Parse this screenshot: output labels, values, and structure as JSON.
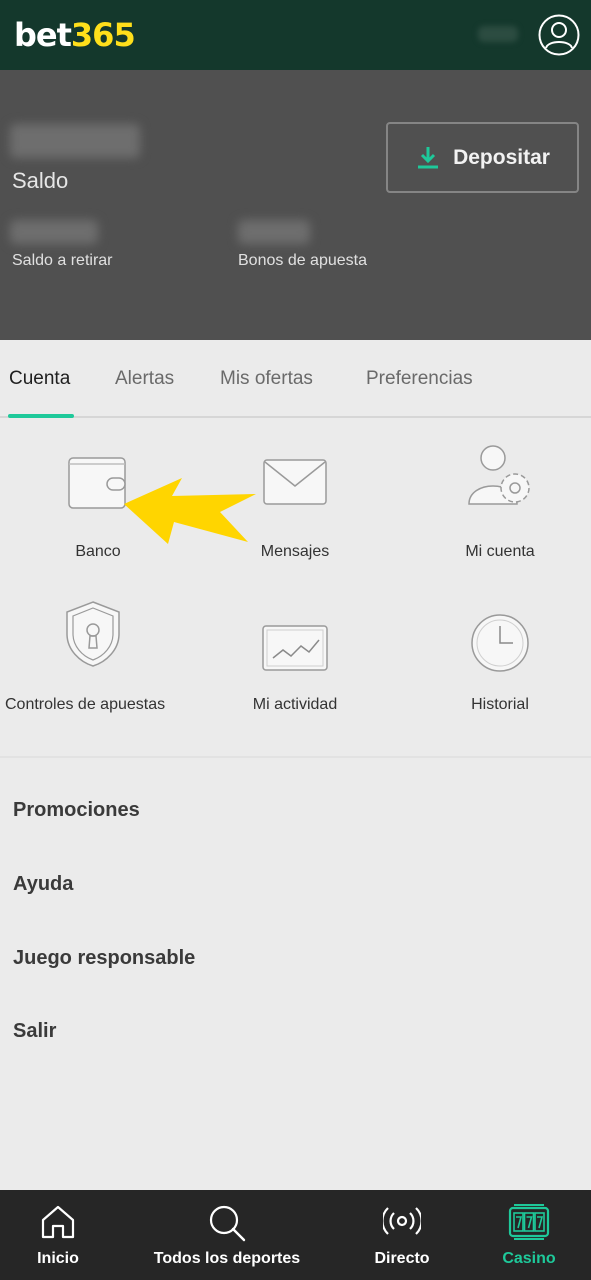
{
  "header": {
    "logo_part1": "bet",
    "logo_part2": "365",
    "account_icon": "user-circle-icon",
    "brand_green": "#14382c",
    "brand_yellow": "#ffdf1b"
  },
  "balance": {
    "saldo_label": "Saldo",
    "withdraw_label": "Saldo a retirar",
    "bonus_label": "Bonos de apuesta",
    "deposit_label": "Depositar",
    "deposit_icon": "download-icon"
  },
  "tabs": [
    {
      "label": "Cuenta",
      "active": true
    },
    {
      "label": "Alertas",
      "active": false
    },
    {
      "label": "Mis ofertas",
      "active": false
    },
    {
      "label": "Preferencias",
      "active": false
    }
  ],
  "grid": [
    {
      "label": "Banco",
      "icon": "wallet-icon"
    },
    {
      "label": "Mensajes",
      "icon": "envelope-icon"
    },
    {
      "label": "Mi cuenta",
      "icon": "user-gear-icon"
    },
    {
      "label": "Controles de apuestas",
      "icon": "shield-lock-icon"
    },
    {
      "label": "Mi actividad",
      "icon": "activity-chart-icon"
    },
    {
      "label": "Historial",
      "icon": "clock-icon"
    }
  ],
  "menu": [
    {
      "label": "Promociones"
    },
    {
      "label": "Ayuda"
    },
    {
      "label": "Juego responsable"
    },
    {
      "label": "Salir"
    }
  ],
  "bottom_nav": [
    {
      "label": "Inicio",
      "icon": "home-icon",
      "active": false
    },
    {
      "label": "Todos los deportes",
      "icon": "search-icon",
      "active": false
    },
    {
      "label": "Directo",
      "icon": "live-broadcast-icon",
      "active": false
    },
    {
      "label": "Casino",
      "icon": "slot-machine-icon",
      "active": true
    }
  ],
  "accent_color": "#1ec99a",
  "annotation_arrow_color": "#ffd500"
}
